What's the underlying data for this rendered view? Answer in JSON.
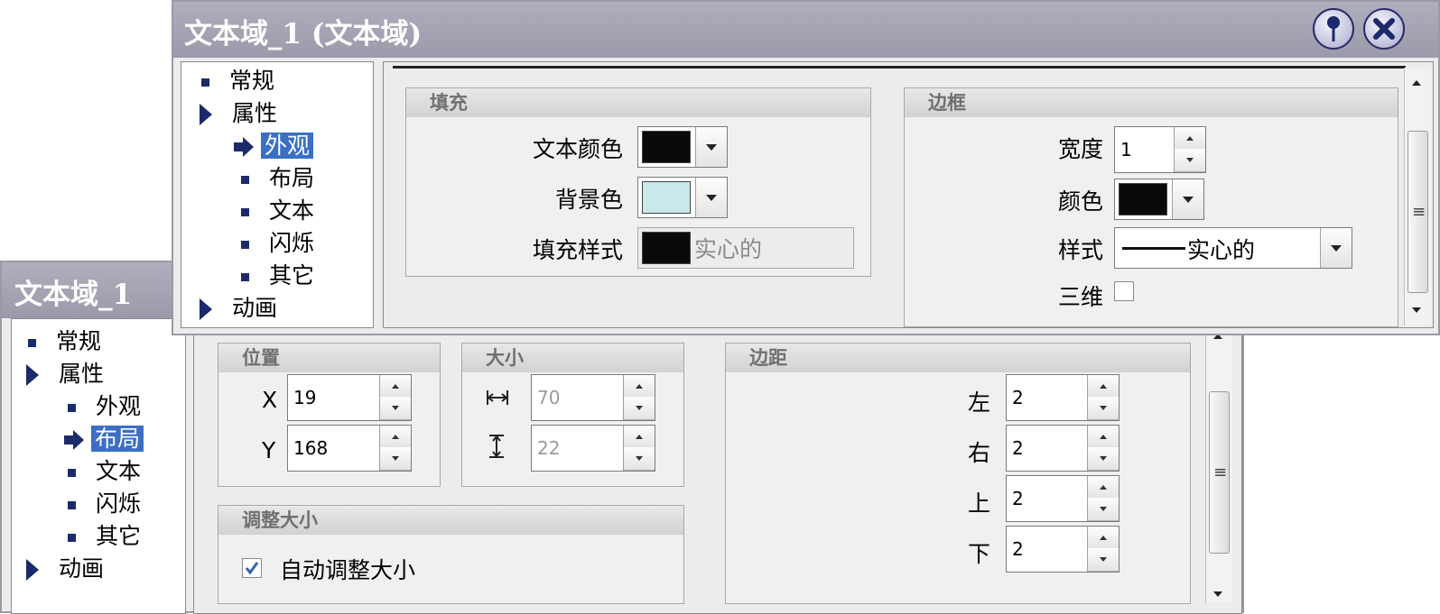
{
  "back_window": {
    "title": "文本域_1",
    "tree": [
      {
        "label": "常规",
        "kind": "square",
        "level": 0
      },
      {
        "label": "属性",
        "kind": "triangle",
        "level": 0
      },
      {
        "label": "外观",
        "kind": "square",
        "level": 1
      },
      {
        "label": "布局",
        "kind": "arrow",
        "level": 1,
        "selected": true
      },
      {
        "label": "文本",
        "kind": "square",
        "level": 1
      },
      {
        "label": "闪烁",
        "kind": "square",
        "level": 1
      },
      {
        "label": "其它",
        "kind": "square",
        "level": 1
      },
      {
        "label": "动画",
        "kind": "triangle",
        "level": 0
      }
    ],
    "position": {
      "header": "位置",
      "x_label": "X",
      "x_value": "19",
      "y_label": "Y",
      "y_value": "168"
    },
    "size": {
      "header": "大小",
      "width_value": "70",
      "height_value": "22"
    },
    "resize": {
      "header": "调整大小",
      "auto_label": "自动调整大小",
      "auto_checked": true
    },
    "margins": {
      "header": "边距",
      "left_label": "左",
      "left_value": "2",
      "right_label": "右",
      "right_value": "2",
      "top_label": "上",
      "top_value": "2",
      "bottom_label": "下",
      "bottom_value": "2"
    }
  },
  "front_window": {
    "title": "文本域_1 (文本域)",
    "tree": [
      {
        "label": "常规",
        "kind": "square",
        "level": 0
      },
      {
        "label": "属性",
        "kind": "triangle",
        "level": 0
      },
      {
        "label": "外观",
        "kind": "arrow",
        "level": 1,
        "selected": true
      },
      {
        "label": "布局",
        "kind": "square",
        "level": 1
      },
      {
        "label": "文本",
        "kind": "square",
        "level": 1
      },
      {
        "label": "闪烁",
        "kind": "square",
        "level": 1
      },
      {
        "label": "其它",
        "kind": "square",
        "level": 1
      },
      {
        "label": "动画",
        "kind": "triangle",
        "level": 0
      }
    ],
    "fill": {
      "header": "填充",
      "text_color_label": "文本颜色",
      "text_color": "#0a0a0a",
      "bg_color_label": "背景色",
      "bg_color": "#c8e8ec",
      "fill_style_label": "填充样式",
      "fill_style_color": "#0a0a0a",
      "fill_style_value": "实心的"
    },
    "border": {
      "header": "边框",
      "width_label": "宽度",
      "width_value": "1",
      "color_label": "颜色",
      "color": "#0a0a0a",
      "style_label": "样式",
      "style_value": "实心的",
      "three_d_label": "三维",
      "three_d_checked": false
    }
  }
}
